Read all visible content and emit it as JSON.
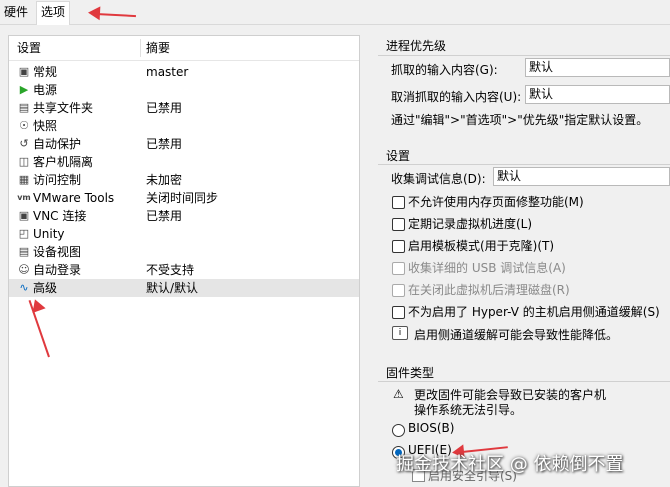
{
  "tabs": [
    {
      "label": "硬件"
    },
    {
      "label": "选项"
    }
  ],
  "list": {
    "headers": {
      "setting": "设置",
      "summary": "摘要"
    },
    "rows": [
      {
        "name": "常规",
        "summary": "master",
        "icon": "monitor-icon"
      },
      {
        "name": "电源",
        "summary": "",
        "icon": "play-icon"
      },
      {
        "name": "共享文件夹",
        "summary": "已禁用",
        "icon": "folder-share-icon"
      },
      {
        "name": "快照",
        "summary": "",
        "icon": "snapshot-icon"
      },
      {
        "name": "自动保护",
        "summary": "已禁用",
        "icon": "autoprotect-icon"
      },
      {
        "name": "客户机隔离",
        "summary": "",
        "icon": "lock-icon"
      },
      {
        "name": "访问控制",
        "summary": "未加密",
        "icon": "access-control-icon"
      },
      {
        "name": "VMware Tools",
        "summary": "关闭时间同步",
        "icon": "vm-icon"
      },
      {
        "name": "VNC 连接",
        "summary": "已禁用",
        "icon": "vnc-icon"
      },
      {
        "name": "Unity",
        "summary": "",
        "icon": "unity-icon"
      },
      {
        "name": "设备视图",
        "summary": "",
        "icon": "device-view-icon"
      },
      {
        "name": "自动登录",
        "summary": "不受支持",
        "icon": "autologin-icon"
      },
      {
        "name": "高级",
        "summary": "默认/默认",
        "icon": "advanced-icon"
      }
    ]
  },
  "priority": {
    "title": "进程优先级",
    "grab_label": "抓取的输入内容(G):",
    "grab_value": "默认",
    "ungrab_label": "取消抓取的输入内容(U):",
    "ungrab_value": "默认",
    "note": "通过\"编辑\">\"首选项\">\"优先级\"指定默认设置。"
  },
  "settings": {
    "title": "设置",
    "debug_label": "收集调试信息(D):",
    "debug_value": "默认",
    "checks": [
      {
        "label": "不允许使用内存页面修整功能(M)",
        "disabled": false
      },
      {
        "label": "定期记录虚拟机进度(L)",
        "disabled": false
      },
      {
        "label": "启用模板模式(用于克隆)(T)",
        "disabled": false
      },
      {
        "label": "收集详细的 USB 调试信息(A)",
        "disabled": true
      },
      {
        "label": "在关闭此虚拟机后清理磁盘(R)",
        "disabled": true
      },
      {
        "label": "不为启用了 Hyper-V 的主机启用侧通道缓解(S)",
        "disabled": false
      }
    ],
    "info": "启用侧通道缓解可能会导致性能降低。"
  },
  "firmware": {
    "title": "固件类型",
    "warning_line1": "更改固件可能会导致已安装的客户机",
    "warning_line2": "操作系统无法引导。",
    "bios": "BIOS(B)",
    "uefi": "UEFI(E)",
    "secure_boot": "启用安全引导(S)"
  },
  "watermark": "掘金技术社区 @ 依赖倒不置",
  "colors": {
    "accent": "#0067c0",
    "annotation": "#e0393e",
    "selection": "#e5e5e5",
    "play": "#2aa52a"
  }
}
